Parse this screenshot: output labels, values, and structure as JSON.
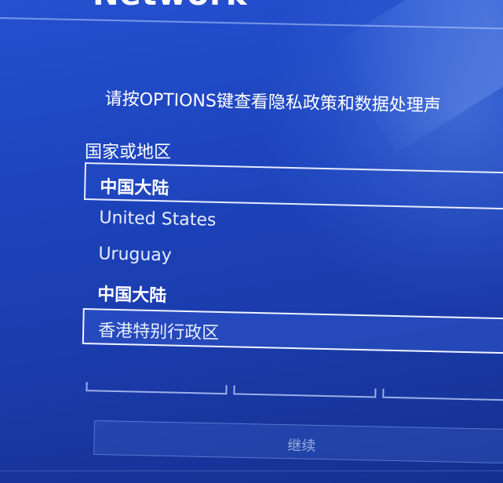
{
  "header": {
    "title": "Network"
  },
  "notice": {
    "text": "请按OPTIONS键查看隐私政策和数据处理声"
  },
  "region_field": {
    "label": "国家或地区",
    "selected_value": "中国大陆",
    "options": [
      {
        "label": "United States",
        "bold": false,
        "focused": false
      },
      {
        "label": "Uruguay",
        "bold": false,
        "focused": false
      },
      {
        "label": "中国大陆",
        "bold": true,
        "focused": false
      },
      {
        "label": "香港特别行政区",
        "bold": false,
        "focused": true
      }
    ]
  },
  "continue_button": {
    "label": "继续",
    "enabled": false
  },
  "colors": {
    "background": "#1d44bd",
    "text": "#ffffff",
    "border": "#e6ecff",
    "disabled_text": "#bec9f0"
  }
}
